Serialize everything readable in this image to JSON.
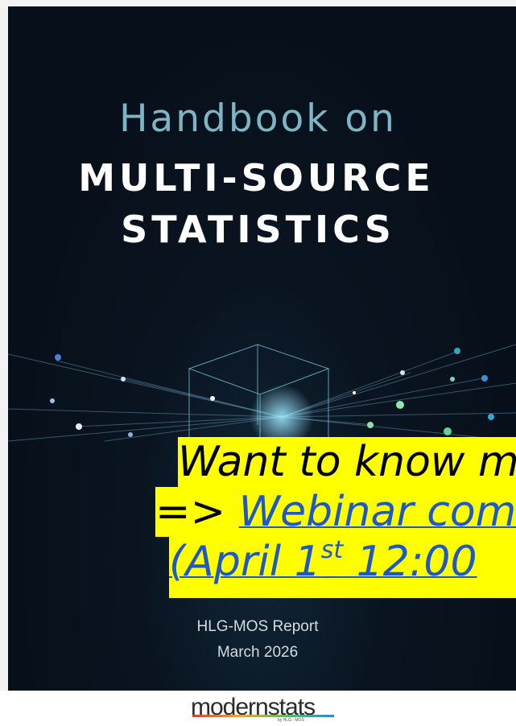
{
  "cover": {
    "title_line1": "Handbook on",
    "title_line2": "MULTI-SOURCE",
    "title_line3": "STATISTICS",
    "report_label": "HLG-MOS Report",
    "report_date": "March 2026"
  },
  "callout": {
    "line1": "Want to know m",
    "line2_prefix": "=> ",
    "line2_link": "Webinar com",
    "line3_open": "(April 1",
    "line3_sup": "st",
    "line3_rest": " 12:00 ",
    "background_color": "#ffff00",
    "link_color": "#1f58c9"
  },
  "footer": {
    "logo_text": "modernstats",
    "logo_sub": "by HLG - MOS"
  }
}
